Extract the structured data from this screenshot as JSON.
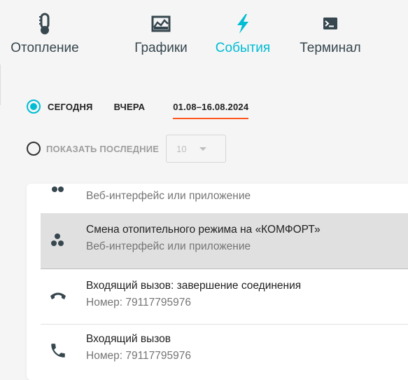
{
  "tabs": [
    {
      "label": "Отопление",
      "icon": "thermometer-icon"
    },
    {
      "label": "Графики",
      "icon": "chart-icon"
    },
    {
      "label": "События",
      "icon": "lightning-icon",
      "active": true
    },
    {
      "label": "Терминал",
      "icon": "terminal-icon"
    }
  ],
  "filter": {
    "today": "СЕГОДНЯ",
    "yesterday": "ВЧЕРА",
    "period": "01.08–16.08.2024",
    "show_last": "ПОКАЗАТЬ ПОСЛЕДНИЕ",
    "show_last_value": "10"
  },
  "events": [
    {
      "line1": "",
      "line2": "Веб-интерфейс или приложение",
      "icon": "mode-dots-icon"
    },
    {
      "line1": "Смена отопительного режима на «КОМФОРТ»",
      "line2": "Веб-интерфейс или приложение",
      "icon": "mode-dots-icon"
    },
    {
      "line1": "Входящий вызов: завершение соединения",
      "line2": "Номер: 79117795976",
      "icon": "hangup-phone-icon"
    },
    {
      "line1": "Входящий вызов",
      "line2": "Номер: 79117795976",
      "icon": "phone-icon"
    }
  ],
  "colors": {
    "accent": "#00bcd4",
    "underline": "#ff5722",
    "icons": "#37474f"
  }
}
